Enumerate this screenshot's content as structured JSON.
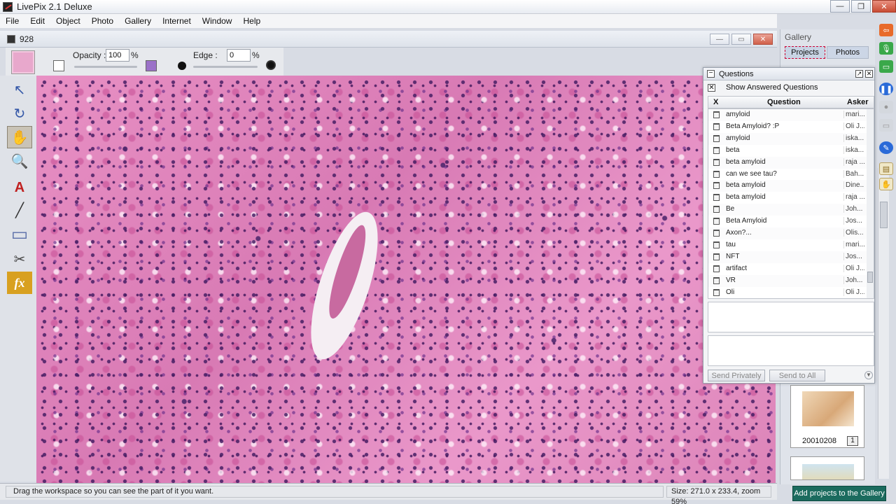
{
  "window": {
    "title": "LivePix 2.1 Deluxe"
  },
  "menu": [
    "File",
    "Edit",
    "Object",
    "Photo",
    "Gallery",
    "Internet",
    "Window",
    "Help"
  ],
  "document": {
    "title": "928"
  },
  "options": {
    "opacity_label": "Opacity :",
    "opacity_value": "100",
    "opacity_unit": "%",
    "edge_label": "Edge :",
    "edge_value": "0",
    "edge_unit": "%"
  },
  "tools": [
    {
      "name": "arrow-tool",
      "glyph": "↖"
    },
    {
      "name": "rotate-tool",
      "glyph": "↻"
    },
    {
      "name": "hand-tool",
      "glyph": "✋"
    },
    {
      "name": "zoom-tool",
      "glyph": "🔍"
    },
    {
      "name": "text-tool",
      "glyph": "A"
    },
    {
      "name": "line-tool",
      "glyph": "╱"
    },
    {
      "name": "shape-tool",
      "glyph": "▭"
    },
    {
      "name": "cutout-tool",
      "glyph": "✂"
    },
    {
      "name": "effects-tool",
      "glyph": "fx"
    }
  ],
  "status": {
    "message": "Drag the workspace so you can see the part of it you want.",
    "size": "Size: 271.0 x 233.4, zoom 59%"
  },
  "gallery": {
    "title": "Gallery",
    "tabs": [
      "Projects",
      "Photos"
    ],
    "thumb_label": "20010208",
    "thumb_badge": "1",
    "add_button": "Add projects to the Gallery"
  },
  "questions": {
    "title": "Questions",
    "show_answered": "Show Answered Questions",
    "columns": {
      "x": "X",
      "question": "Question",
      "asker": "Asker"
    },
    "rows": [
      {
        "q": "amyloid",
        "a": "mari..."
      },
      {
        "q": "Beta Amyloid? :P",
        "a": "Oli J..."
      },
      {
        "q": "amyloid",
        "a": "iska..."
      },
      {
        "q": "beta",
        "a": "iska..."
      },
      {
        "q": "beta amyloid",
        "a": "raja ..."
      },
      {
        "q": "can we see tau?",
        "a": "Bah..."
      },
      {
        "q": "beta amyloid",
        "a": "Dine..."
      },
      {
        "q": "beta amyloid",
        "a": "raja ..."
      },
      {
        "q": "Be",
        "a": "Joh..."
      },
      {
        "q": "Beta Amyloid",
        "a": "Jos..."
      },
      {
        "q": "Axon?...",
        "a": "Olis..."
      },
      {
        "q": "tau",
        "a": "mari..."
      },
      {
        "q": "NFT",
        "a": "Jos..."
      },
      {
        "q": "artifact",
        "a": "Oli J..."
      },
      {
        "q": "VR",
        "a": "Joh..."
      },
      {
        "q": "Oli",
        "a": "Oli J..."
      }
    ],
    "send_private": "Send Privately",
    "send_all": "Send to All"
  },
  "colors": {
    "accent": "#1b6b5e",
    "tissue_pink": "#e08ac0",
    "nuclei": "#4a2a6e"
  }
}
